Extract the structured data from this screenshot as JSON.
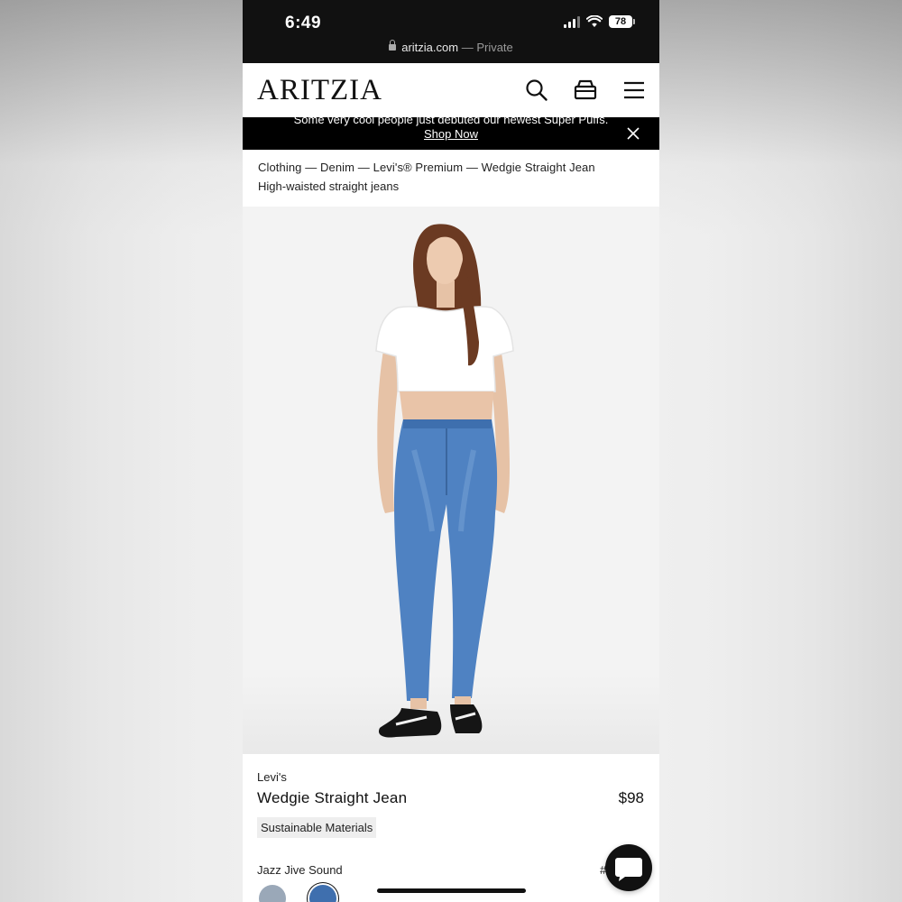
{
  "status_bar": {
    "time": "6:49",
    "battery": "78"
  },
  "browser": {
    "domain": "aritzia.com",
    "private_label": "— Private"
  },
  "header": {
    "logo": "ARITZIA"
  },
  "promo": {
    "text": "Some very cool people just debuted our newest Super Puffs.",
    "link": "Shop Now"
  },
  "breadcrumb": "Clothing — Denim — Levi's® Premium — Wedgie Straight Jean",
  "subtitle": "High-waisted straight jeans",
  "product": {
    "brand": "Levi's",
    "name": "Wedgie Straight Jean",
    "price": "$98",
    "badge": "Sustainable Materials",
    "color_name": "Jazz Jive Sound",
    "color_extra": "#"
  },
  "colors": {
    "selected_swatch": "#3f6fae",
    "alt_swatch": "#9aa8b8",
    "accent": "#111111"
  }
}
